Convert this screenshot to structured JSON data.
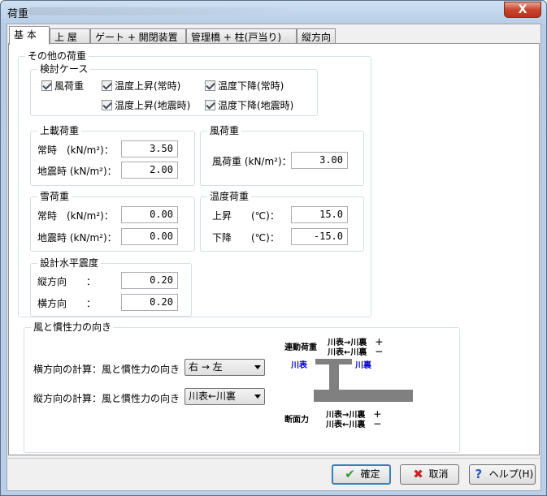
{
  "window": {
    "title": "荷重",
    "close_label": "X"
  },
  "tabs": [
    "基 本",
    "上 屋",
    "ゲート + 開閉装置",
    "管理橋 + 柱(戸当り)",
    "縦方向"
  ],
  "other_loads": {
    "title": "その他の荷重",
    "case": {
      "title": "検討ケース",
      "items": [
        "風荷重",
        "温度上昇(常時)",
        "温度下降(常時)",
        "温度上昇(地震時)",
        "温度下降(地震時)"
      ]
    },
    "deck_load": {
      "title": "上載荷重",
      "rows": [
        {
          "label": "常時　(kN/m²)：",
          "value": "3.50"
        },
        {
          "label": "地震時 (kN/m²)：",
          "value": "2.00"
        }
      ]
    },
    "wind_load": {
      "title": "風荷重",
      "rows": [
        {
          "label": "風荷重 (kN/m²)：",
          "value": "3.00"
        }
      ]
    },
    "snow_load": {
      "title": "雪荷重",
      "rows": [
        {
          "label": "常時　(kN/m²)：",
          "value": "0.00"
        },
        {
          "label": "地震時 (kN/m²)：",
          "value": "0.00"
        }
      ]
    },
    "temp_load": {
      "title": "温度荷重",
      "rows": [
        {
          "label": "上昇　　(℃)：",
          "value": "15.0"
        },
        {
          "label": "下降　　(℃)：",
          "value": "-15.0"
        }
      ]
    },
    "seismic": {
      "title": "設計水平震度",
      "rows": [
        {
          "label": "縦方向　　：",
          "value": "0.20"
        },
        {
          "label": "横方向　　：",
          "value": "0.20"
        }
      ]
    }
  },
  "direction": {
    "title": "風と慣性力の向き",
    "lateral_label": "横方向の計算：風と慣性力の向き",
    "lateral_value": "右 → 左",
    "longitudinal_label": "縦方向の計算：風と慣性力の向き",
    "longitudinal_value": "川表←川裏",
    "diagram": {
      "top_title": "連動荷重",
      "top_line1": "川表→川裏　＋",
      "top_line2": "川表←川裏　－",
      "left_tag": "川表",
      "right_tag": "川裏",
      "bottom_title": "断面力",
      "bottom_line1": "川表→川裏　＋",
      "bottom_line2": "川表←川裏　－",
      "tag_color": "#0000cc"
    }
  },
  "buttons": {
    "ok": "確定",
    "cancel": "取消",
    "help": "ヘルプ(H)"
  }
}
